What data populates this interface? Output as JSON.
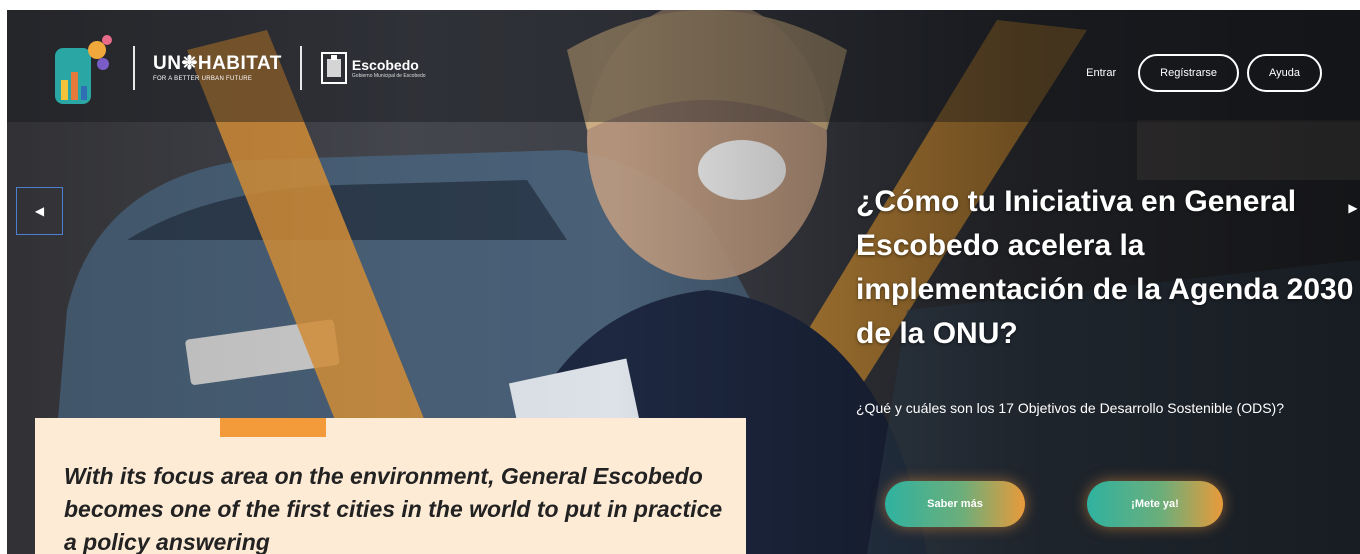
{
  "brand": {
    "un_title": "UN❉HABITAT",
    "un_sub": "FOR A BETTER URBAN FUTURE",
    "esc_title": "Escobedo",
    "esc_sub": "Gobierno Municipal de Escobedo"
  },
  "nav": {
    "login": "Entrar",
    "register": "Regístrarse",
    "help": "Ayuda"
  },
  "carousel": {
    "prev_icon": "◀",
    "next_icon": "▶"
  },
  "hero": {
    "headline": "¿Cómo tu Iniciativa en General Escobedo acelera la implementación de la Agenda 2030 de la ONU?",
    "subtext": "¿Qué y cuáles son los 17 Objetivos de Desarrollo Sostenible (ODS)?",
    "cta_primary": "Saber más",
    "cta_secondary": "¡Mete ya!"
  },
  "quote": {
    "text": "With its focus area on the environment, General Escobedo becomes one of the first cities in the world to put in practice a policy answering"
  },
  "colors": {
    "accent_orange": "#f39a3a",
    "accent_teal": "#2fb2a0",
    "quote_bg": "#fdebd6"
  }
}
